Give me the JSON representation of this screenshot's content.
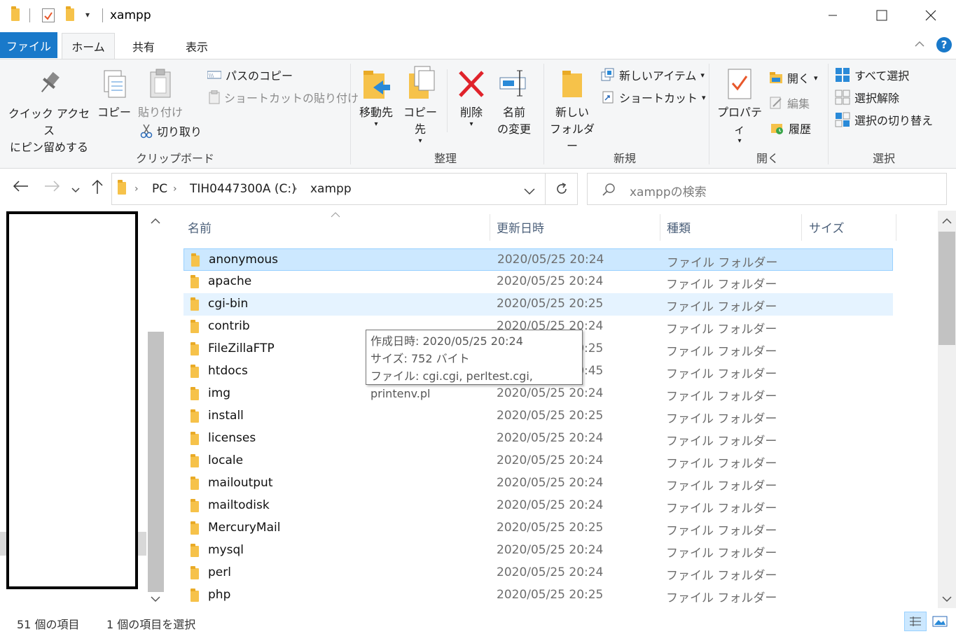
{
  "window": {
    "title": "xampp"
  },
  "ribbon": {
    "tabs": {
      "file": "ファイル",
      "home": "ホーム",
      "share": "共有",
      "view": "表示"
    },
    "clipboard": {
      "pin_line1": "クイック アクセス",
      "pin_line2": "にピン留めする",
      "copy": "コピー",
      "paste": "貼り付け",
      "copy_path": "パスのコピー",
      "paste_shortcut": "ショートカットの貼り付け",
      "cut": "切り取り",
      "group": "クリップボード"
    },
    "organize": {
      "move_to": "移動先",
      "copy_to": "コピー先",
      "delete": "削除",
      "rename_line1": "名前",
      "rename_line2": "の変更",
      "group": "整理"
    },
    "new": {
      "folder_line1": "新しい",
      "folder_line2": "フォルダー",
      "new_item": "新しいアイテム",
      "shortcut": "ショートカット",
      "group": "新規"
    },
    "open": {
      "properties": "プロパティ",
      "open": "開く",
      "edit": "編集",
      "history": "履歴",
      "group": "開く"
    },
    "select": {
      "select_all": "すべて選択",
      "select_none": "選択解除",
      "invert": "選択の切り替え",
      "group": "選択"
    }
  },
  "address": {
    "crumbs": [
      "PC",
      "TIH0447300A (C:)",
      "xampp"
    ],
    "search_placeholder": "xamppの検索"
  },
  "columns": {
    "name": "名前",
    "modified": "更新日時",
    "type": "種類",
    "size": "サイズ"
  },
  "files": [
    {
      "name": "anonymous",
      "date": "2020/05/25 20:24",
      "type": "ファイル フォルダー"
    },
    {
      "name": "apache",
      "date": "2020/05/25 20:24",
      "type": "ファイル フォルダー"
    },
    {
      "name": "cgi-bin",
      "date": "2020/05/25 20:25",
      "type": "ファイル フォルダー"
    },
    {
      "name": "contrib",
      "date": "2020/05/25 20:24",
      "type": "ファイル フォルダー"
    },
    {
      "name": "FileZillaFTP",
      "date": "2020/05/25 20:25",
      "type": "ファイル フォルダー"
    },
    {
      "name": "htdocs",
      "date": "2020/05/25 20:45",
      "type": "ファイル フォルダー"
    },
    {
      "name": "img",
      "date": "2020/05/25 20:24",
      "type": "ファイル フォルダー"
    },
    {
      "name": "install",
      "date": "2020/05/25 20:25",
      "type": "ファイル フォルダー"
    },
    {
      "name": "licenses",
      "date": "2020/05/25 20:24",
      "type": "ファイル フォルダー"
    },
    {
      "name": "locale",
      "date": "2020/05/25 20:24",
      "type": "ファイル フォルダー"
    },
    {
      "name": "mailoutput",
      "date": "2020/05/25 20:24",
      "type": "ファイル フォルダー"
    },
    {
      "name": "mailtodisk",
      "date": "2020/05/25 20:24",
      "type": "ファイル フォルダー"
    },
    {
      "name": "MercuryMail",
      "date": "2020/05/25 20:25",
      "type": "ファイル フォルダー"
    },
    {
      "name": "mysql",
      "date": "2020/05/25 20:24",
      "type": "ファイル フォルダー"
    },
    {
      "name": "perl",
      "date": "2020/05/25 20:24",
      "type": "ファイル フォルダー"
    },
    {
      "name": "php",
      "date": "2020/05/25 20:25",
      "type": "ファイル フォルダー"
    }
  ],
  "tooltip": {
    "line1": "作成日時: 2020/05/25 20:24",
    "line2": "サイズ: 752 バイト",
    "line3": "ファイル: cgi.cgi, perltest.cgi, printenv.pl"
  },
  "status": {
    "count": "51 個の項目",
    "selected": "1 個の項目を選択"
  },
  "colors": {
    "accent": "#1979ca",
    "selection": "#cce8ff",
    "hover": "#e5f3ff",
    "folder": "#f6c24a"
  }
}
